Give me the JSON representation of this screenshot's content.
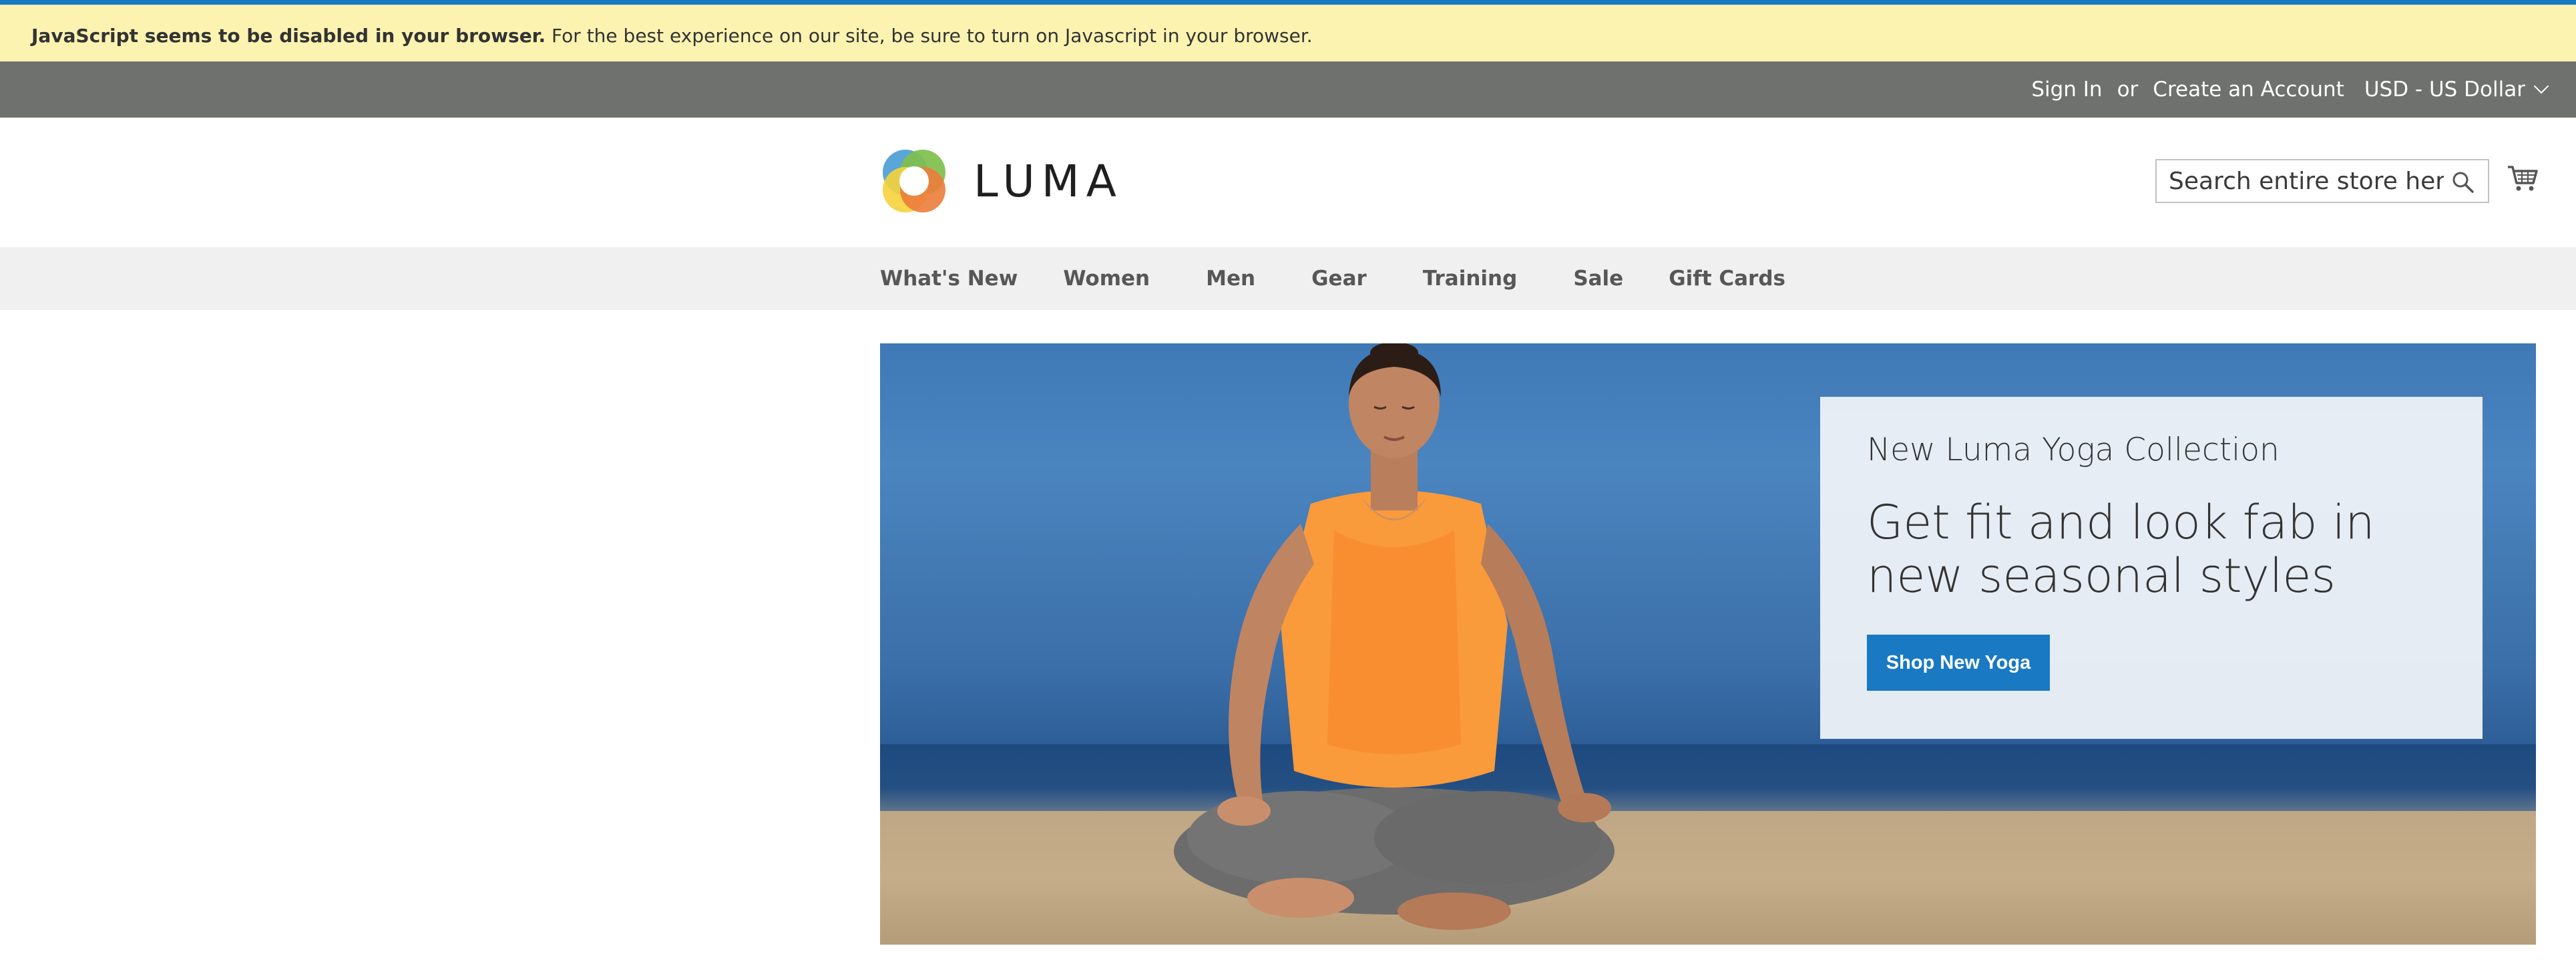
{
  "notice": {
    "bold": "JavaScript seems to be disabled in your browser.",
    "text": " For the best experience on our site, be sure to turn on Javascript in your browser."
  },
  "panel": {
    "sign_in": "Sign In",
    "or": "or",
    "create_account": "Create an Account",
    "currency": "USD - US Dollar"
  },
  "header": {
    "logo_text": "LUMA",
    "search_placeholder": "Search entire store here...",
    "icons": {
      "search": "search-icon",
      "cart": "cart-icon"
    }
  },
  "nav": {
    "items": [
      "What's New",
      "Women",
      "Men",
      "Gear",
      "Training",
      "Sale",
      "Gift Cards"
    ]
  },
  "hero": {
    "subtitle": "New Luma Yoga Collection",
    "title": "Get fit and look fab in new seasonal styles",
    "button": "Shop New Yoga"
  },
  "colors": {
    "notice_bg": "#fcf3b1",
    "panel_bg": "#6e716e",
    "nav_bg": "#f0f0f0",
    "accent": "#1979c3"
  }
}
